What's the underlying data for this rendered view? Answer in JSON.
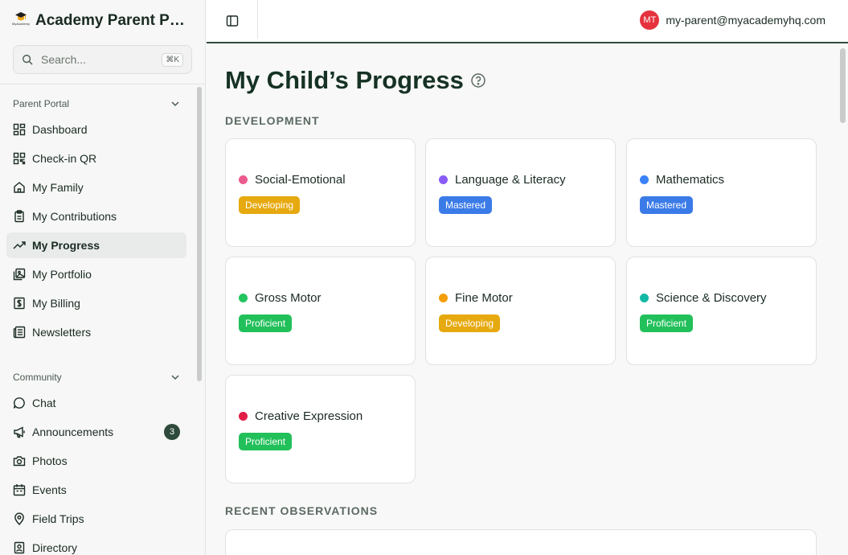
{
  "app": {
    "title": "Academy Parent Portal",
    "logo_text": "MyAcademy"
  },
  "search": {
    "placeholder": "Search...",
    "shortcut": "⌘K"
  },
  "sidebar": {
    "groups": [
      {
        "title": "Parent Portal",
        "items": [
          {
            "label": "Dashboard",
            "icon": "dashboard-icon"
          },
          {
            "label": "Check-in QR",
            "icon": "qr-code-icon"
          },
          {
            "label": "My Family",
            "icon": "home-icon"
          },
          {
            "label": "My Contributions",
            "icon": "clipboard-icon"
          },
          {
            "label": "My Progress",
            "icon": "trending-up-icon",
            "active": true
          },
          {
            "label": "My Portfolio",
            "icon": "portfolio-icon"
          },
          {
            "label": "My Billing",
            "icon": "billing-icon"
          },
          {
            "label": "Newsletters",
            "icon": "newspaper-icon"
          }
        ]
      },
      {
        "title": "Community",
        "items": [
          {
            "label": "Chat",
            "icon": "chat-icon"
          },
          {
            "label": "Announcements",
            "icon": "megaphone-icon",
            "badge": "3"
          },
          {
            "label": "Photos",
            "icon": "camera-icon"
          },
          {
            "label": "Events",
            "icon": "calendar-icon"
          },
          {
            "label": "Field Trips",
            "icon": "map-pin-icon"
          },
          {
            "label": "Directory",
            "icon": "contact-icon"
          }
        ]
      }
    ]
  },
  "header": {
    "user_initials": "MT",
    "user_email": "my-parent@myacademyhq.com"
  },
  "main": {
    "title": "My Child’s Progress",
    "development_label": "DEVELOPMENT",
    "observations_label": "RECENT OBSERVATIONS",
    "domains": [
      {
        "name": "Social-Emotional",
        "status": "Developing",
        "dot_color": "#ec5b8f",
        "status_color": "#e6a90f"
      },
      {
        "name": "Language & Literacy",
        "status": "Mastered",
        "dot_color": "#8b5cf6",
        "status_color": "#3b7be8"
      },
      {
        "name": "Mathematics",
        "status": "Mastered",
        "dot_color": "#3b82f6",
        "status_color": "#3b7be8"
      },
      {
        "name": "Gross Motor",
        "status": "Proficient",
        "dot_color": "#22c55e",
        "status_color": "#22c05a"
      },
      {
        "name": "Fine Motor",
        "status": "Developing",
        "dot_color": "#f59e0b",
        "status_color": "#e6a90f"
      },
      {
        "name": "Science & Discovery",
        "status": "Proficient",
        "dot_color": "#14b8a6",
        "status_color": "#22c05a"
      },
      {
        "name": "Creative Expression",
        "status": "Proficient",
        "dot_color": "#e11d48",
        "status_color": "#22c05a"
      }
    ]
  },
  "colors": {
    "accent": "#2f4d3e",
    "avatar": "#e5323d"
  }
}
